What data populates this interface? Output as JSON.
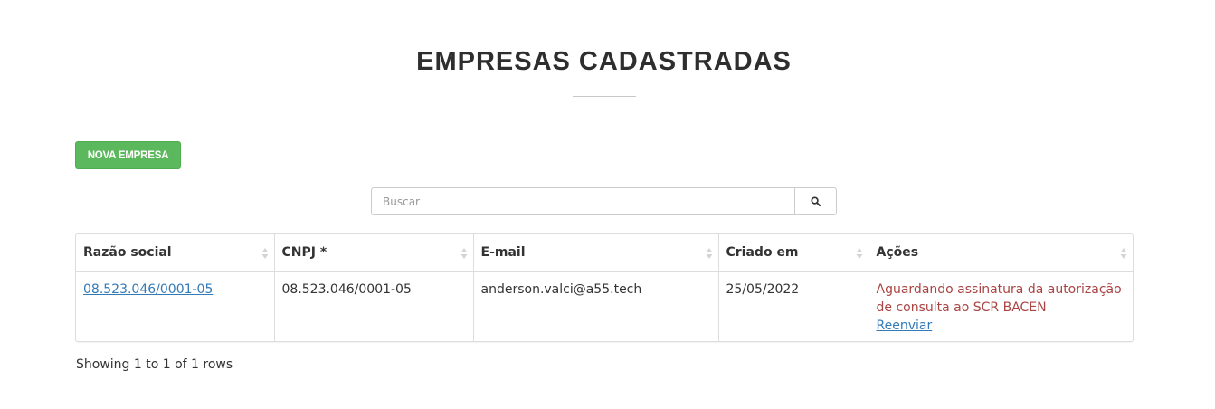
{
  "page": {
    "title": "EMPRESAS CADASTRADAS"
  },
  "toolbar": {
    "new_company_label": "NOVA EMPRESA"
  },
  "search": {
    "placeholder": "Buscar",
    "value": "",
    "icon": "search-icon"
  },
  "table": {
    "headers": [
      "Razão social",
      "CNPJ *",
      "E-mail",
      "Criado em",
      "Ações"
    ],
    "rows": [
      {
        "razao_social": "08.523.046/0001-05",
        "cnpj": "08.523.046/0001-05",
        "email": "anderson.valci@a55.tech",
        "criado_em": "25/05/2022",
        "acoes_status": "Aguardando assinatura da autorização de consulta ao SCR BACEN",
        "acoes_link": "Reenviar"
      }
    ]
  },
  "pagination": {
    "summary": "Showing 1 to 1 of 1 rows"
  },
  "colors": {
    "primary_button": "#5cb85c",
    "link": "#337ab7",
    "status_warning": "#a94442"
  }
}
